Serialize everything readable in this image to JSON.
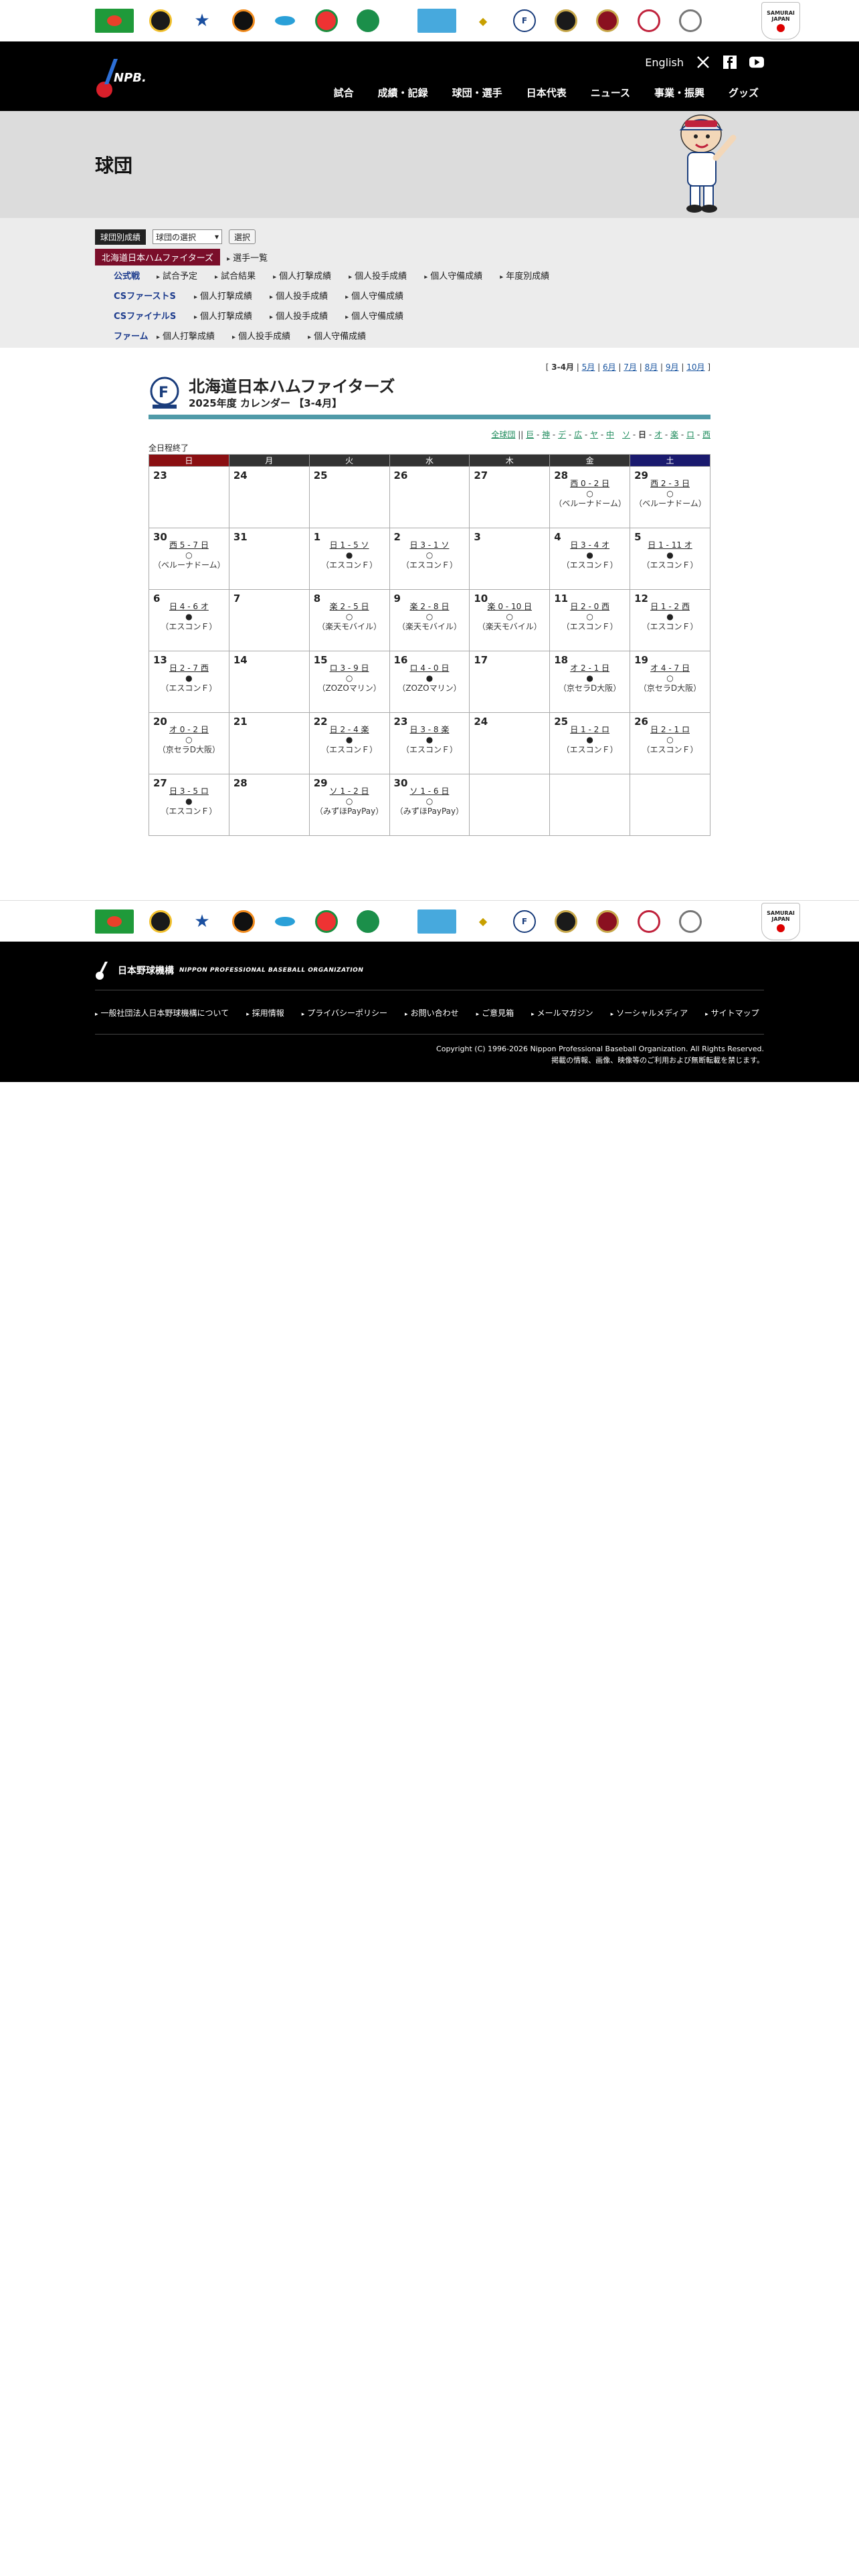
{
  "header": {
    "lang_link": "English",
    "nav": [
      "試合",
      "成績・記録",
      "球団・選手",
      "日本代表",
      "ニュース",
      "事業・振興",
      "グッズ"
    ]
  },
  "page_title": "球団",
  "submenu": {
    "team_label": "球団別成績",
    "select_value": "球団の選択",
    "select_button": "選択",
    "team_name": "北海道日本ハムファイターズ",
    "player_list": "選手一覧",
    "rows": [
      {
        "head": "公式戦",
        "items": [
          "試合予定",
          "試合結果",
          "個人打撃成績",
          "個人投手成績",
          "個人守備成績",
          "年度別成績"
        ]
      },
      {
        "head": "CSファーストS",
        "items": [
          "個人打撃成績",
          "個人投手成績",
          "個人守備成績"
        ]
      },
      {
        "head": "CSファイナルS",
        "items": [
          "個人打撃成績",
          "個人投手成績",
          "個人守備成績"
        ]
      },
      {
        "head": "ファーム",
        "items": [
          "個人打撃成績",
          "個人投手成績",
          "個人守備成績"
        ]
      }
    ]
  },
  "calendar": {
    "month_nav": {
      "current": "3-4月",
      "links": [
        "5月",
        "6月",
        "7月",
        "8月",
        "9月",
        "10月"
      ]
    },
    "team_name": "北海道日本ハムファイターズ",
    "subtitle": "2025年度 カレンダー 【3-4月】",
    "team_links": {
      "all": "全球団",
      "teams": [
        "巨",
        "神",
        "デ",
        "広",
        "ヤ",
        "中",
        "ソ",
        "日",
        "オ",
        "楽",
        "ロ",
        "西"
      ],
      "current": "日"
    },
    "note": "全日程終了",
    "weekdays": [
      "日",
      "月",
      "火",
      "水",
      "木",
      "金",
      "土"
    ],
    "weeks": [
      [
        {
          "d": "23"
        },
        {
          "d": "24"
        },
        {
          "d": "25"
        },
        {
          "d": "26"
        },
        {
          "d": "27"
        },
        {
          "d": "28",
          "s": "西 0 - 2 日",
          "m": "○",
          "v": "（ベルーナドーム）"
        },
        {
          "d": "29",
          "s": "西 2 - 3 日",
          "m": "○",
          "v": "（ベルーナドーム）"
        }
      ],
      [
        {
          "d": "30",
          "s": "西 5 - 7 日",
          "m": "○",
          "v": "（ベルーナドーム）"
        },
        {
          "d": "31"
        },
        {
          "d": "1",
          "s": "日 1 - 5 ソ",
          "m": "●",
          "v": "（エスコンＦ）"
        },
        {
          "d": "2",
          "s": "日 3 - 1 ソ",
          "m": "○",
          "v": "（エスコンＦ）"
        },
        {
          "d": "3"
        },
        {
          "d": "4",
          "s": "日 3 - 4 オ",
          "m": "●",
          "v": "（エスコンＦ）"
        },
        {
          "d": "5",
          "s": "日 1 - 11 オ",
          "m": "●",
          "v": "（エスコンＦ）"
        }
      ],
      [
        {
          "d": "6",
          "s": "日 4 - 6 オ",
          "m": "●",
          "v": "（エスコンＦ）"
        },
        {
          "d": "7"
        },
        {
          "d": "8",
          "s": "楽 2 - 5 日",
          "m": "○",
          "v": "（楽天モバイル）"
        },
        {
          "d": "9",
          "s": "楽 2 - 8 日",
          "m": "○",
          "v": "（楽天モバイル）"
        },
        {
          "d": "10",
          "s": "楽 0 - 10 日",
          "m": "○",
          "v": "（楽天モバイル）"
        },
        {
          "d": "11",
          "s": "日 2 - 0 西",
          "m": "○",
          "v": "（エスコンＦ）"
        },
        {
          "d": "12",
          "s": "日 1 - 2 西",
          "m": "●",
          "v": "（エスコンＦ）"
        }
      ],
      [
        {
          "d": "13",
          "s": "日 2 - 7 西",
          "m": "●",
          "v": "（エスコンＦ）"
        },
        {
          "d": "14"
        },
        {
          "d": "15",
          "s": "ロ 3 - 9 日",
          "m": "○",
          "v": "（ZOZOマリン）"
        },
        {
          "d": "16",
          "s": "ロ 4 - 0 日",
          "m": "●",
          "v": "（ZOZOマリン）"
        },
        {
          "d": "17"
        },
        {
          "d": "18",
          "s": "オ 2 - 1 日",
          "m": "●",
          "v": "（京セラD大阪）"
        },
        {
          "d": "19",
          "s": "オ 4 - 7 日",
          "m": "○",
          "v": "（京セラD大阪）"
        }
      ],
      [
        {
          "d": "20",
          "s": "オ 0 - 2 日",
          "m": "○",
          "v": "（京セラD大阪）"
        },
        {
          "d": "21"
        },
        {
          "d": "22",
          "s": "日 2 - 4 楽",
          "m": "●",
          "v": "（エスコンＦ）"
        },
        {
          "d": "23",
          "s": "日 3 - 8 楽",
          "m": "●",
          "v": "（エスコンＦ）"
        },
        {
          "d": "24"
        },
        {
          "d": "25",
          "s": "日 1 - 2 ロ",
          "m": "●",
          "v": "（エスコンＦ）"
        },
        {
          "d": "26",
          "s": "日 2 - 1 ロ",
          "m": "○",
          "v": "（エスコンＦ）"
        }
      ],
      [
        {
          "d": "27",
          "s": "日 3 - 5 ロ",
          "m": "●",
          "v": "（エスコンＦ）"
        },
        {
          "d": "28"
        },
        {
          "d": "29",
          "s": "ソ 1 - 2 日",
          "m": "○",
          "v": "（みずほPayPay）"
        },
        {
          "d": "30",
          "s": "ソ 1 - 6 日",
          "m": "○",
          "v": "（みずほPayPay）"
        },
        {
          "d": ""
        },
        {
          "d": ""
        },
        {
          "d": ""
        }
      ]
    ]
  },
  "footer": {
    "org_jp": "日本野球機構",
    "org_en": "NIPPON PROFESSIONAL BASEBALL ORGANIZATION",
    "links": [
      "一般社団法人日本野球機構について",
      "採用情報",
      "プライバシーポリシー",
      "お問い合わせ",
      "ご意見箱",
      "メールマガジン",
      "ソーシャルメディア",
      "サイトマップ"
    ],
    "copyright": "Copyright (C) 1996-2026 Nippon Professional Baseball Organization. All Rights Reserved.",
    "notice": "掲載の情報、画像、映像等のご利用および無断転載を禁じます。"
  }
}
